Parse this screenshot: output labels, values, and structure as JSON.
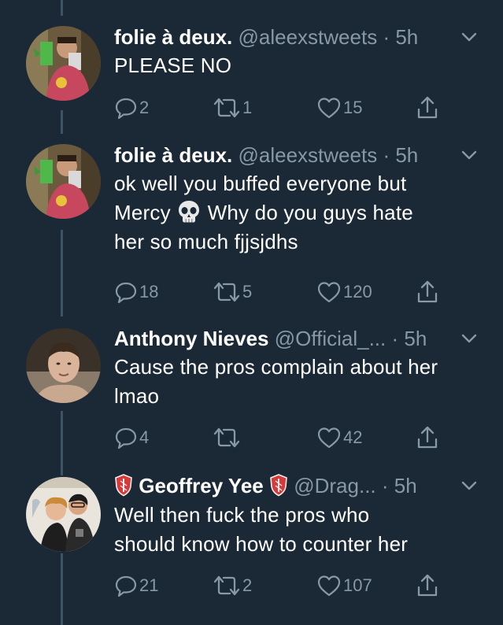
{
  "tweets": [
    {
      "name": "folie à deux.",
      "handle": "@aleexstweets",
      "dot": "·",
      "time": "5h",
      "text": "PLEASE NO",
      "avatar_icon": "profile-photo",
      "replies": "2",
      "retweets": "1",
      "likes": "15"
    },
    {
      "name": "folie à deux.",
      "handle": "@aleexstweets",
      "dot": "·",
      "time": "5h",
      "text_line1": "ok well you buffed everyone but",
      "text_line2a": "Mercy",
      "text_line2b": "Why do you guys hate",
      "text_line3": "her so much fjjsjdhs",
      "emoji": "skull-icon",
      "avatar_icon": "profile-photo",
      "replies": "18",
      "retweets": "5",
      "likes": "120"
    },
    {
      "name": "Anthony Nieves",
      "handle": "@Official_...",
      "dot": "·",
      "time": "5h",
      "text_line1": "Cause the pros complain about her",
      "text_line2": "lmao",
      "avatar_icon": "profile-photo",
      "replies": "4",
      "retweets": "",
      "likes": "42"
    },
    {
      "name": "Geoffrey Yee",
      "handle": "@Drag...",
      "dot": "·",
      "time": "5h",
      "text_line1": "Well then fuck the pros who",
      "text_line2": "should know how to counter her",
      "avatar_icon": "profile-photo",
      "name_badge_icon": "shield-badge-icon",
      "replies": "21",
      "retweets": "2",
      "likes": "107"
    }
  ],
  "colors": {
    "background": "#1b2836",
    "text_primary": "#ffffff",
    "text_secondary": "#8899a6",
    "thread_line": "#3d5466"
  }
}
